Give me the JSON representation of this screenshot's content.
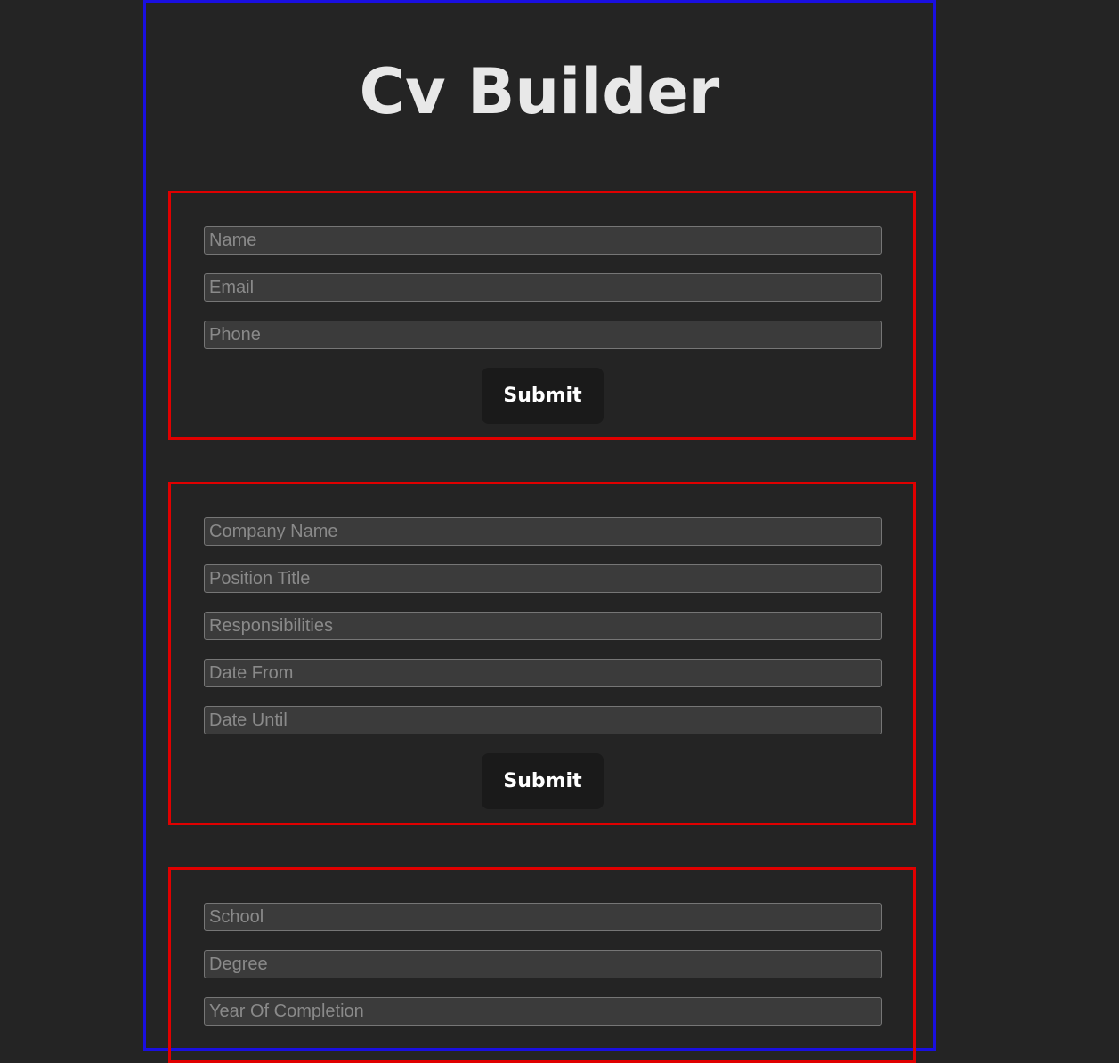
{
  "app": {
    "title": "Cv Builder"
  },
  "general_info": {
    "name_placeholder": "Name",
    "email_placeholder": "Email",
    "phone_placeholder": "Phone",
    "submit_label": "Submit"
  },
  "experience": {
    "company_placeholder": "Company Name",
    "position_placeholder": "Position Title",
    "responsibilities_placeholder": "Responsibilities",
    "date_from_placeholder": "Date From",
    "date_until_placeholder": "Date Until",
    "submit_label": "Submit"
  },
  "education": {
    "school_placeholder": "School",
    "degree_placeholder": "Degree",
    "year_placeholder": "Year Of Completion"
  },
  "colors": {
    "background": "#242424",
    "outer_border": "#1a0fe0",
    "form_border": "#e00000",
    "input_background": "#3b3b3b",
    "button_background": "#1a1a1a"
  }
}
